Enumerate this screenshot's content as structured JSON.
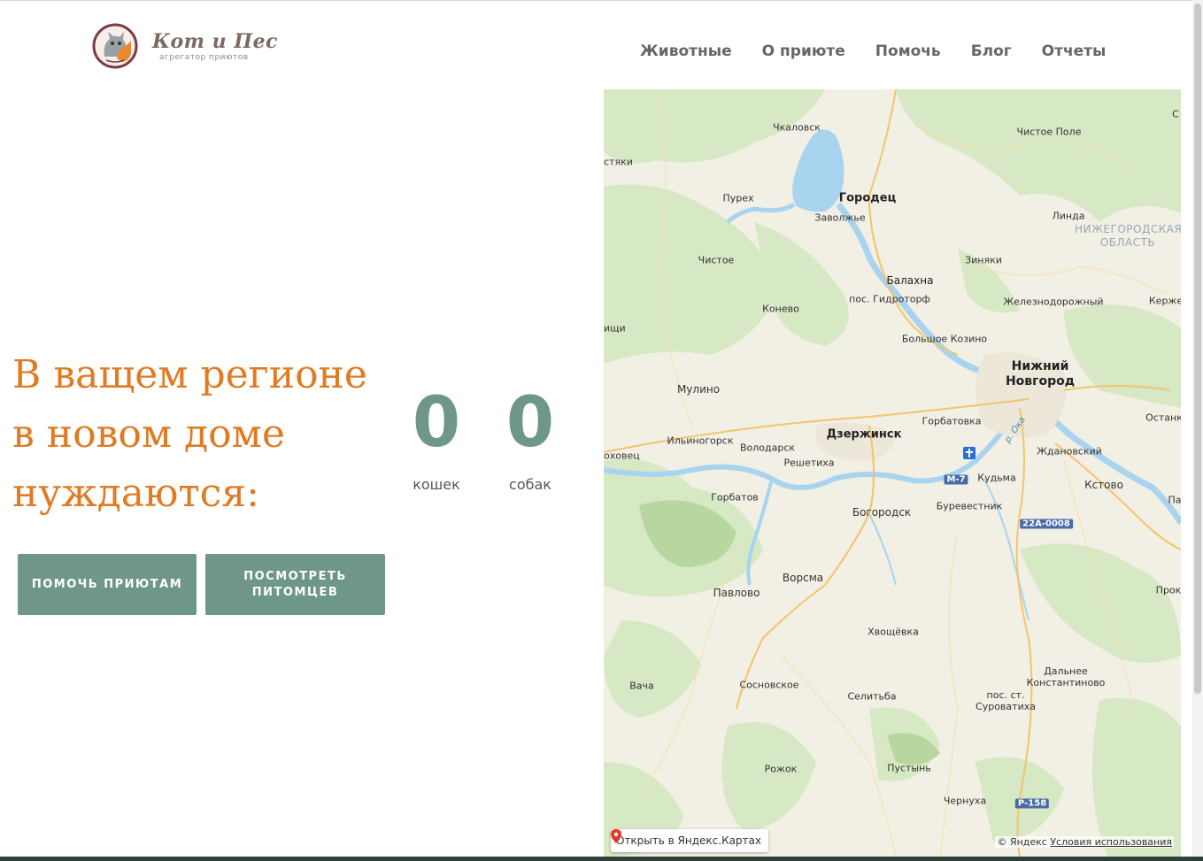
{
  "brand": {
    "name": "Кот и Пес",
    "tagline": "агрегатор приютов"
  },
  "nav": {
    "items": [
      {
        "label": "Животные"
      },
      {
        "label": "О приюте"
      },
      {
        "label": "Помочь"
      },
      {
        "label": "Блог"
      },
      {
        "label": "Отчеты"
      }
    ]
  },
  "hero": {
    "title": "В ващем регионе в новом доме нуждаются:"
  },
  "counters": {
    "cats": {
      "value": "0",
      "label": "кошек"
    },
    "dogs": {
      "value": "0",
      "label": "собак"
    }
  },
  "buttons": {
    "help_shelters": "ПОМОЧЬ ПРИЮТАМ",
    "view_pets": "ПОСМОТРЕТЬ ПИТОМЦЕВ"
  },
  "map": {
    "open_link": "Открыть в Яндекс.Картах",
    "attribution": "© Яндекс",
    "terms": "Условия использования",
    "places": {
      "chkalovsk": "Чкаловск",
      "chistoe_pole": "Чистое Поле",
      "styaki": "стяки",
      "purekh": "Пурех",
      "gorodets": "Городец",
      "zavolzhye": "Заволжье",
      "linda": "Линда",
      "region": "НИЖЕГОРОДСКАЯ ОБЛАСТЬ",
      "chistoe": "Чистое",
      "zinyaki": "Зиняки",
      "balakhna": "Балахна",
      "gidrotorf": "пос. Гидроторф",
      "zheleznodorozhny": "Железнодорожный",
      "kerzhe": "Керже",
      "konevo": "Конево",
      "ishchi": "ищи",
      "bolshoe_kozino": "Большое Козино",
      "nizhny_novgorod": "Нижний Новгород",
      "mulino": "Мулино",
      "ostank": "Останк",
      "gorbatovka": "Горбатовка",
      "dzerzhinsk": "Дзержинск",
      "ilinogorsk": "Ильиногорск",
      "volodarsk": "Володарск",
      "reshetikha": "Решетиха",
      "okhovets": "оховец",
      "zhdanovsky": "Ждановский",
      "river_oka": "р. Ока",
      "road_m7": "М-7",
      "kudma": "Кудьма",
      "kstovo": "Кстово",
      "pa": "Па",
      "gorbatov": "Горбатов",
      "burevestnik": "Буревестник",
      "bogorodsk": "Богородск",
      "road_22a": "22А-0008",
      "vorsma": "Ворсма",
      "pavlovo": "Павлово",
      "prok": "Прок",
      "khvoschevka": "Хвощёвка",
      "dalnee_konstantinovo": "Дальнее Константиново",
      "vacha": "Вача",
      "sosnovskoe": "Сосновское",
      "selitba": "Селитьба",
      "surovatikha": "пос. ст. Суроватиха",
      "rozhok": "Рожок",
      "pustyn": "Пустынь",
      "chernukha": "Чернуха",
      "road_r158": "Р-158",
      "c_edge": "С"
    }
  }
}
